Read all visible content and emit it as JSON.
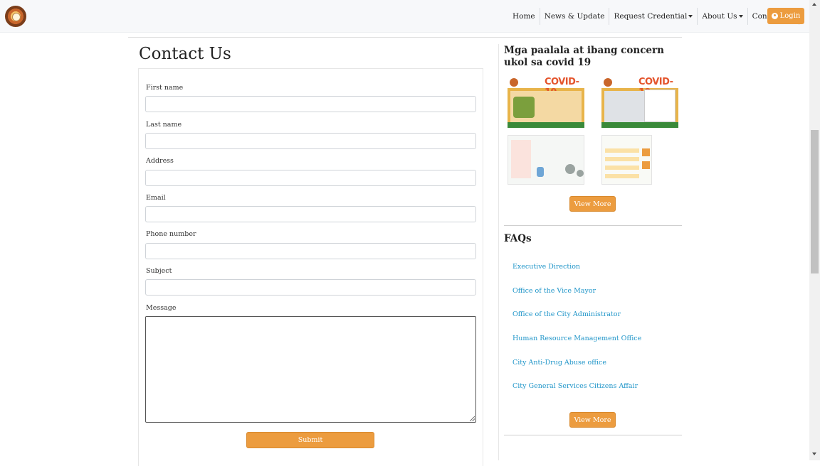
{
  "nav": {
    "items": [
      {
        "label": "Home"
      },
      {
        "label": "News & Update"
      },
      {
        "label": "Request Credential",
        "dropdown": true
      },
      {
        "label": "About Us",
        "dropdown": true
      },
      {
        "label": "Contact Us"
      }
    ],
    "login_label": "Login"
  },
  "page": {
    "title": "Contact Us"
  },
  "form": {
    "fields": [
      {
        "label": "First name",
        "value": ""
      },
      {
        "label": "Last name",
        "value": ""
      },
      {
        "label": "Address",
        "value": ""
      },
      {
        "label": "Email",
        "value": ""
      },
      {
        "label": "Phone number",
        "value": ""
      },
      {
        "label": "Subject",
        "value": ""
      }
    ],
    "message_label": "Message",
    "message_value": "",
    "submit_label": "Submit"
  },
  "sidebar": {
    "covid_heading": "Mga paalala at ibang concern ukol sa covid 19",
    "thumbnails": [
      {
        "title": "COVID-19",
        "icon": "covid-poster-1"
      },
      {
        "title": "COVID-19",
        "icon": "covid-poster-2"
      },
      {
        "title": "",
        "icon": "coronavirus-poster"
      },
      {
        "title": "",
        "icon": "kontra-covid-poster"
      }
    ],
    "view_more_label": "View More",
    "faq_heading": "FAQs",
    "faq_links": [
      "Executive Direction",
      "Office of the Vice Mayor",
      "Office of the City Administrator",
      "Human Resource Management Office",
      "City Anti-Drug Abuse office",
      "City General Services Citizens Affair"
    ],
    "faq_view_more_label": "View More"
  },
  "colors": {
    "accent": "#ec9c3f",
    "link": "#2196c9",
    "navbar_bg": "#f7f8fa"
  }
}
